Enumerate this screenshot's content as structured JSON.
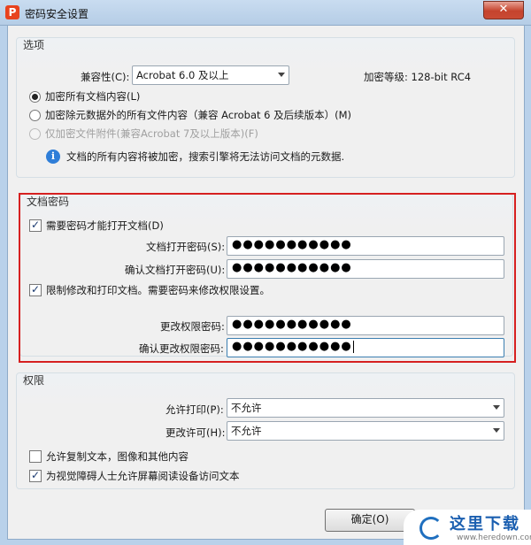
{
  "window": {
    "title": "密码安全设置",
    "close_label": "✕",
    "app_icon_letter": "P"
  },
  "options": {
    "legend": "选项",
    "compat_label": "兼容性(C):",
    "compat_value": "Acrobat 6.0 及以上",
    "encrypt_level": "加密等级: 128-bit RC4",
    "radio_all": "加密所有文档内容(L)",
    "radio_except_meta": "加密除元数据外的所有文件内容（兼容 Acrobat 6 及后续版本）(M)",
    "radio_attach": "仅加密文件附件(兼容Acrobat 7及以上版本)(F)",
    "info": "文档的所有内容将被加密，搜索引擎将无法访问文档的元数据."
  },
  "doc_password": {
    "legend": "文档密码",
    "require_label": "需要密码才能打开文档(D)",
    "open_label": "文档打开密码(S):",
    "open_value": "●●●●●●●●●●●",
    "confirm_open_label": "确认文档打开密码(U):",
    "confirm_open_value": "●●●●●●●●●●●",
    "restrict_label": "限制修改和打印文档。需要密码来修改权限设置。",
    "change_label": "更改权限密码:",
    "change_value": "●●●●●●●●●●●",
    "confirm_change_label": "确认更改权限密码:",
    "confirm_change_value": "●●●●●●●●●●●"
  },
  "permissions": {
    "legend": "权限",
    "print_label": "允许打印(P):",
    "print_value": "不允许",
    "change_label": "更改许可(H):",
    "change_value": "不允许",
    "copy_label": "允许复制文本，图像和其他内容",
    "screenreader_label": "为视觉障碍人士允许屏幕阅读设备访问文本"
  },
  "buttons": {
    "ok": "确定(O)"
  },
  "watermark": {
    "text": "这里下载",
    "url": "www.heredown.com"
  },
  "colors": {
    "highlight_frame": "#d62020",
    "title_bg": "#c9dcf0"
  }
}
